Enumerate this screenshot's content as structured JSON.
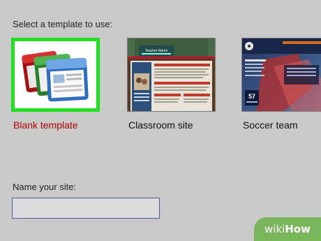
{
  "heading": "Select a template to use:",
  "templates": [
    {
      "label": "Blank template",
      "selected": true
    },
    {
      "label": "Classroom site",
      "preview_title": "Teacher Name"
    },
    {
      "label": "Soccer team",
      "preview_score": "57"
    }
  ],
  "site_name": {
    "label": "Name your site:",
    "value": ""
  },
  "watermark": {
    "part1": "wiki",
    "part2": "How"
  },
  "colors": {
    "selection": "#20e020",
    "selected_label": "#b30000",
    "watermark": "#7ab55c"
  }
}
